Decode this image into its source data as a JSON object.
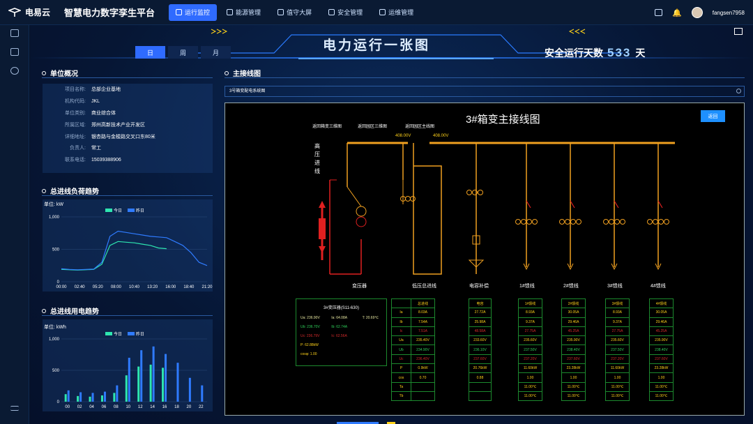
{
  "brand": {
    "name": "电易云",
    "platform": "智慧电力数字孪生平台"
  },
  "nav": [
    {
      "label": "运行监控",
      "active": true,
      "icon": "monitor-icon"
    },
    {
      "label": "能源管理",
      "active": false,
      "icon": "energy-icon"
    },
    {
      "label": "值守大屏",
      "active": false,
      "icon": "screen-icon"
    },
    {
      "label": "安全管理",
      "active": false,
      "icon": "shield-icon"
    },
    {
      "label": "运维管理",
      "active": false,
      "icon": "tools-icon"
    }
  ],
  "user": {
    "name": "fangsen7958"
  },
  "header": {
    "title": "电力运行一张图",
    "safety_label": "安全运行天数",
    "safety_days": "533",
    "safety_unit": "天"
  },
  "tabs": [
    {
      "label": "日",
      "active": true
    },
    {
      "label": "周",
      "active": false
    },
    {
      "label": "月",
      "active": false
    }
  ],
  "overview": {
    "title": "单位概况",
    "rows": [
      {
        "k": "项目名称:",
        "v": "总部企业基地"
      },
      {
        "k": "机构代码:",
        "v": "JKL"
      },
      {
        "k": "单位类别:",
        "v": "商业综合体"
      },
      {
        "k": "所属区域:",
        "v": "郑州高新技术产业开发区"
      },
      {
        "k": "详细地址:",
        "v": "银杏路与金梭路交叉口东80米"
      },
      {
        "k": "负责人:",
        "v": "常工"
      },
      {
        "k": "联系电话:",
        "v": "15039388906"
      }
    ]
  },
  "load_chart": {
    "title": "总进线负荷趋势",
    "unit": "单位: kW",
    "legend": [
      "今日",
      "昨日"
    ],
    "chart_data": {
      "type": "line",
      "x": [
        "00:00",
        "02:40",
        "05:20",
        "08:00",
        "10:40",
        "13:20",
        "16:00",
        "18:40",
        "21:20"
      ],
      "ylim": [
        0,
        1000
      ],
      "yticks": [
        "1,000",
        "500",
        "0"
      ],
      "series": [
        {
          "name": "今日",
          "color": "#2ee6b0",
          "values": [
            190,
            185,
            180,
            185,
            190,
            270,
            560,
            620,
            610,
            600,
            580,
            560,
            520,
            510,
            null,
            null,
            null,
            null,
            null
          ]
        },
        {
          "name": "昨日",
          "color": "#2f7bff",
          "values": [
            200,
            190,
            185,
            190,
            195,
            300,
            700,
            780,
            760,
            740,
            720,
            700,
            690,
            680,
            620,
            560,
            450,
            300,
            250
          ]
        }
      ]
    }
  },
  "energy_chart": {
    "title": "总进线用电趋势",
    "unit": "单位: kWh",
    "legend": [
      "今日",
      "昨日"
    ],
    "chart_data": {
      "type": "bar",
      "categories": [
        "00",
        "02",
        "04",
        "06",
        "08",
        "10",
        "12",
        "14",
        "16",
        "18",
        "20",
        "22"
      ],
      "ylim": [
        0,
        1000
      ],
      "yticks": [
        "1,000",
        "500",
        "0"
      ],
      "series": [
        {
          "name": "今日",
          "color": "#2ee6b0",
          "values": [
            120,
            90,
            80,
            100,
            140,
            420,
            560,
            590,
            540,
            0,
            0,
            0
          ]
        },
        {
          "name": "昨日",
          "color": "#2f7bff",
          "values": [
            180,
            150,
            140,
            160,
            260,
            700,
            820,
            880,
            760,
            620,
            380,
            260
          ]
        }
      ]
    }
  },
  "diagram": {
    "section_title": "主接线图",
    "search_value": "3号箱变配电系统图",
    "title": "3#箱变主接线图",
    "back_label": "返回",
    "links": [
      "返回箱变三维图",
      "返回园区三维图",
      "返回园区主线图"
    ],
    "voltage": "408.00V",
    "incoming": "高压进线",
    "captions": [
      "变压器",
      "低压总进线",
      "电容补偿",
      "1#馈线",
      "2#馈线",
      "3#馈线",
      "4#馈线"
    ],
    "transformer_panel": {
      "title": "3#变压器(S11-630)",
      "rows": [
        {
          "a": "Ua: 236.90V",
          "b": "Ia: 64.08A",
          "c": "T: 20.69℃"
        },
        {
          "a": "Ub: 236.70V",
          "b": "Ib: 62.74A",
          "c": ""
        },
        {
          "a": "Uc: 236.79V",
          "b": "Ic: 62.56A",
          "c": ""
        },
        {
          "a": "P: 62.88kW",
          "b": "",
          "c": ""
        },
        {
          "a": "cosφ: 1.00",
          "b": "",
          "c": ""
        }
      ]
    },
    "table_labels": [
      "Ia",
      "Ib",
      "Ic",
      "Ua",
      "Ub",
      "Uc",
      "P",
      "cos",
      "Ta",
      "Tb"
    ],
    "columns": [
      {
        "head": "总进线",
        "vals": [
          "8.03A",
          "7.54A",
          "7.51A",
          "235.40V",
          "234.90V",
          "236.40V",
          "0.9kW",
          "0.70",
          "",
          ""
        ]
      },
      {
        "head": "电容",
        "vals": [
          "27.72A",
          "25.98A",
          "48.58A",
          "233.60V",
          "236.10V",
          "237.60V",
          "20.76kW",
          "0.88",
          "",
          ""
        ]
      },
      {
        "head": "1#馈线",
        "vals": [
          "8.93A",
          "9.37A",
          "27.75A",
          "235.60V",
          "237.50V",
          "237.20V",
          "11.60kW",
          "1.00",
          "11.00℃",
          "11.00℃"
        ]
      },
      {
        "head": "2#馈线",
        "vals": [
          "30.05A",
          "29.46A",
          "45.25A",
          "235.90V",
          "238.40V",
          "237.60V",
          "23.28kW",
          "1.00",
          "11.00℃",
          "11.00℃"
        ]
      },
      {
        "head": "3#馈线",
        "vals": [
          "8.93A",
          "9.37A",
          "27.75A",
          "235.60V",
          "237.50V",
          "237.20V",
          "11.60kW",
          "1.00",
          "11.00℃",
          "11.00℃"
        ]
      },
      {
        "head": "4#馈线",
        "vals": [
          "30.05A",
          "29.46A",
          "45.25A",
          "235.90V",
          "238.40V",
          "237.60V",
          "23.28kW",
          "1.00",
          "11.00℃",
          "11.00℃"
        ]
      }
    ]
  }
}
